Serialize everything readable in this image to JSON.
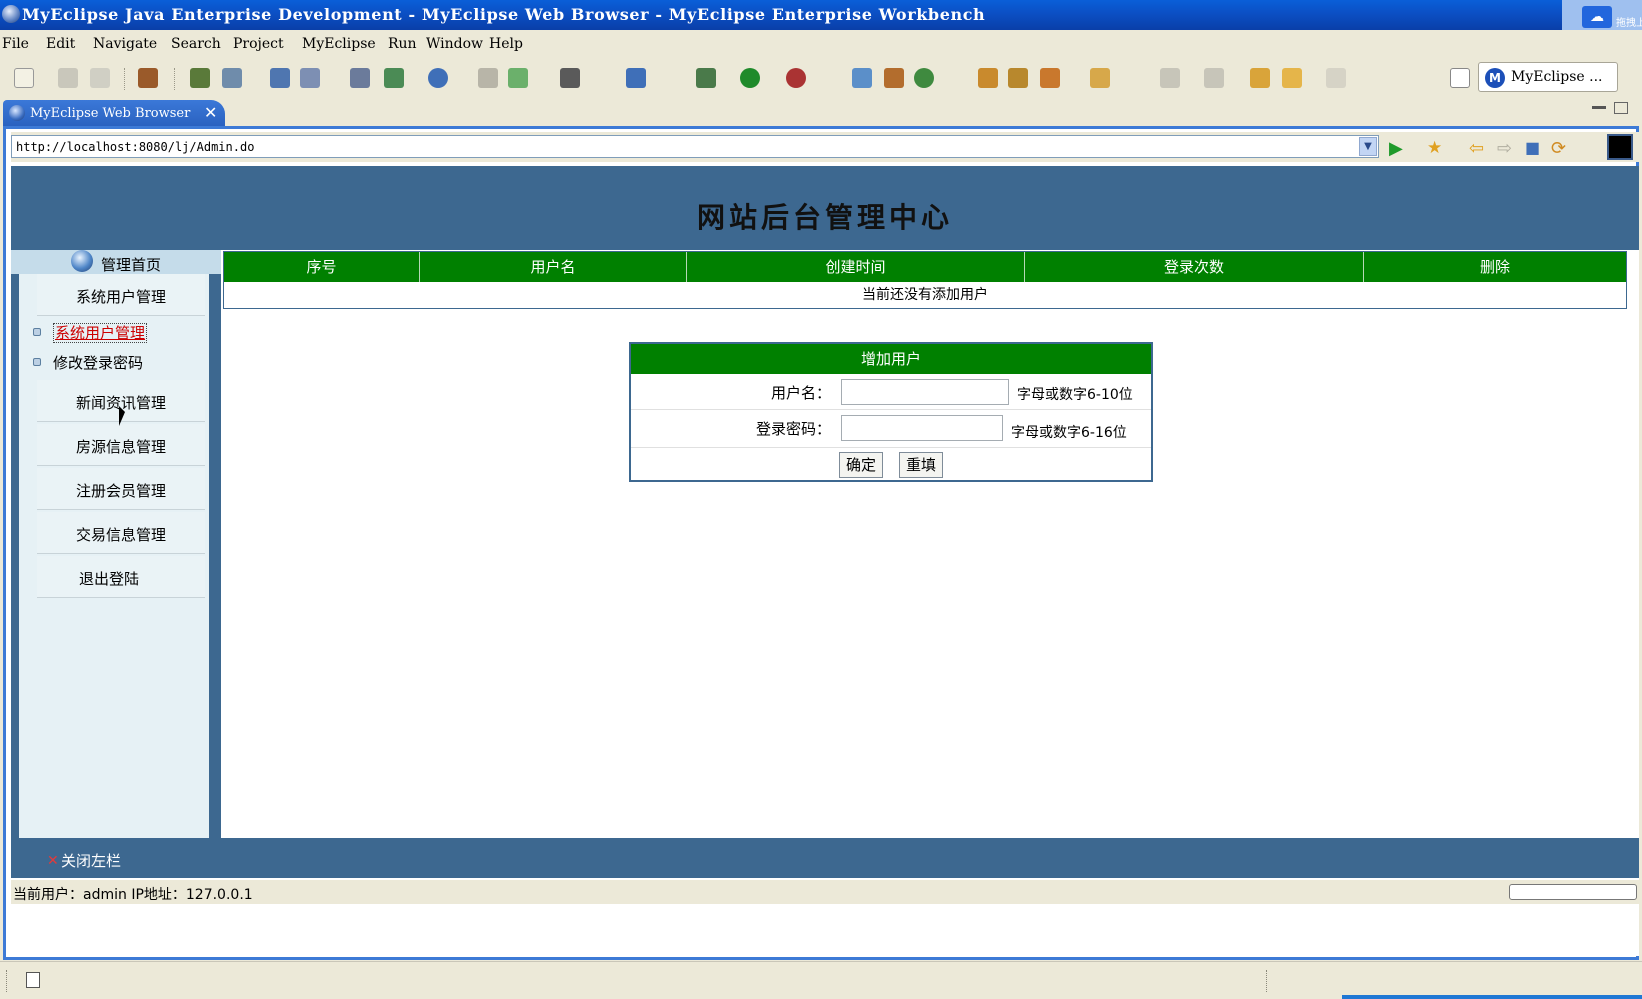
{
  "window": {
    "title": "MyEclipse Java Enterprise Development - MyEclipse Web Browser - MyEclipse Enterprise Workbench",
    "tray_text": "拖拽上"
  },
  "menu": [
    "File",
    "Edit",
    "Navigate",
    "Search",
    "Project",
    "MyEclipse",
    "Run",
    "Window",
    "Help"
  ],
  "perspective": {
    "label": "MyEclipse ..."
  },
  "editor_tab": {
    "label": "MyEclipse Web Browser"
  },
  "browser": {
    "url": "http://localhost:8080/lj/Admin.do"
  },
  "site": {
    "title": "网站后台管理中心"
  },
  "sidebar": {
    "home": "管理首页",
    "items": [
      {
        "label": "系统用户管理"
      },
      {
        "label": "新闻资讯管理"
      },
      {
        "label": "房源信息管理"
      },
      {
        "label": "注册会员管理"
      },
      {
        "label": "交易信息管理"
      },
      {
        "label": "退出登陆"
      }
    ],
    "sub_items": [
      {
        "label": "系统用户管理"
      },
      {
        "label": "修改登录密码"
      }
    ]
  },
  "user_table": {
    "columns": [
      "序号",
      "用户名",
      "创建时间",
      "登录次数",
      "删除"
    ],
    "empty_message": "当前还没有添加用户"
  },
  "add_form": {
    "title": "增加用户",
    "username_label": "用户名：",
    "username_hint": "字母或数字6-10位",
    "password_label": "登录密码：",
    "password_hint": "字母或数字6-16位",
    "submit": "确定",
    "reset": "重填"
  },
  "footer": {
    "close_sidebar": "关闭左栏",
    "status": "当前用户：admin  IP地址：127.0.0.1"
  },
  "colors": {
    "header_blue": "#3d6890",
    "table_green": "#008000",
    "active_red": "#cc0000"
  }
}
